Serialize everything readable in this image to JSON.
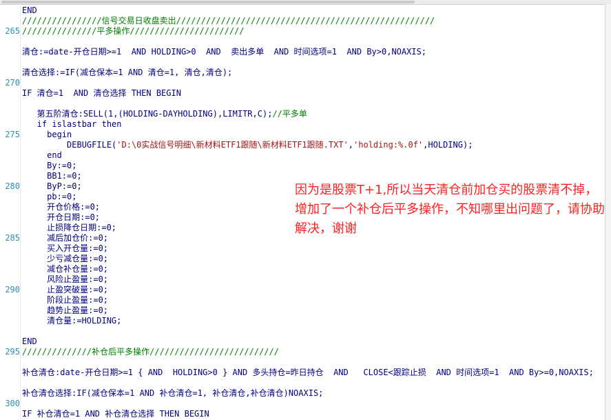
{
  "editor": {
    "lines": [
      {
        "num": "",
        "text": "END",
        "style": "code"
      },
      {
        "num": "",
        "text": "////////////////信号交易日收盘卖出////////////////////////////////////////////////////",
        "style": "comment"
      },
      {
        "num": "265",
        "text": "///////////////平多操作///////////////////////",
        "style": "comment"
      },
      {
        "num": "",
        "text": "",
        "style": "code"
      },
      {
        "num": "",
        "text": "清仓:=date-开仓日期>=1  AND HOLDING>0  AND  卖出多单  AND 时间选项=1  AND By>0,NOAXIS;",
        "style": "code"
      },
      {
        "num": "",
        "text": "",
        "style": "code"
      },
      {
        "num": "",
        "text": "清仓选择:=IF(减仓保本=1 AND 清仓=1, 清仓,清仓);",
        "style": "code"
      },
      {
        "num": "270",
        "text": "",
        "style": "code"
      },
      {
        "num": "",
        "text": "IF 清仓=1  AND 清仓选择 THEN BEGIN",
        "style": "code"
      },
      {
        "num": "",
        "text": "",
        "style": "code"
      },
      {
        "num": "",
        "text": "   第五阶清仓:SELL(1,(HOLDING-DAYHOLDING),LIMITR,C);",
        "comment": "//平多单",
        "style": "code"
      },
      {
        "num": "",
        "text": "   if islastbar then",
        "style": "code"
      },
      {
        "num": "275",
        "text": "     begin",
        "style": "code"
      },
      {
        "num": "",
        "text": "         DEBUGFILE(",
        "str1": "'D:\\0实战信号明细\\新材料ETF1跟随\\新材料ETF1跟随.TXT'",
        "sep": ",",
        "str2": "'holding:%.0f'",
        "tail": ",HOLDING);",
        "style": "code"
      },
      {
        "num": "",
        "text": "     end",
        "style": "code"
      },
      {
        "num": "",
        "text": "     By:=0;",
        "style": "code"
      },
      {
        "num": "",
        "text": "     BB1:=0;",
        "style": "code"
      },
      {
        "num": "280",
        "text": "     ByP:=0;",
        "style": "code"
      },
      {
        "num": "",
        "text": "     pb:=0;",
        "style": "code"
      },
      {
        "num": "",
        "text": "     开仓价格:=0;",
        "style": "code"
      },
      {
        "num": "",
        "text": "     开仓日期:=0;",
        "style": "code"
      },
      {
        "num": "",
        "text": "     止损降仓日期:=0;",
        "style": "code"
      },
      {
        "num": "285",
        "text": "     减后加仓价:=0;",
        "style": "code"
      },
      {
        "num": "",
        "text": "     买入开仓量:=0;",
        "style": "code"
      },
      {
        "num": "",
        "text": "     少亏减仓量:=0;",
        "style": "code"
      },
      {
        "num": "",
        "text": "     减仓补仓量:=0;",
        "style": "code"
      },
      {
        "num": "",
        "text": "     风险止盈量:=0;",
        "style": "code"
      },
      {
        "num": "290",
        "text": "     止盈突破量:=0;",
        "style": "code"
      },
      {
        "num": "",
        "text": "     阶段止盈量:=0;",
        "style": "code"
      },
      {
        "num": "",
        "text": "     趋势止盈量:=0;",
        "style": "code"
      },
      {
        "num": "",
        "text": "     清仓量:=HOLDING;",
        "style": "code"
      },
      {
        "num": "",
        "text": "",
        "style": "code"
      },
      {
        "num": "",
        "text": "END",
        "style": "code"
      },
      {
        "num": "295",
        "text": "//////////////补仓后平多操作//////////////////////////",
        "style": "comment"
      },
      {
        "num": "",
        "text": "",
        "style": "code"
      },
      {
        "num": "",
        "text": "补仓清仓:date-开仓日期>=1 { AND  HOLDING>0 } AND 多头持仓=昨日持仓  AND   CLOSE<跟踪止损  AND 时间选项=1  AND By>=0,NOAXIS;",
        "style": "code"
      },
      {
        "num": "",
        "text": "",
        "style": "code"
      },
      {
        "num": "",
        "text": "补仓清仓选择:IF(减仓保本=1 AND 补仓清仓=1, 补仓清仓,补仓清仓)NOAXIS;",
        "style": "code"
      },
      {
        "num": "300",
        "text": "",
        "style": "code"
      },
      {
        "num": "",
        "text": "IF 补仓清仓=1 AND 补仓清仓选择 THEN BEGIN",
        "style": "code"
      }
    ]
  },
  "annotation": {
    "text": "因为是股票T+1,所以当天清仓前加仓买的股票清不掉，增加了一个补仓后平多操作，不知哪里出问题了，请协助解决，谢谢",
    "color": "#ff2020"
  },
  "colors": {
    "keyword": "#000080",
    "comment": "#008000",
    "string": "#a31515",
    "line_number": "#2b91af"
  }
}
